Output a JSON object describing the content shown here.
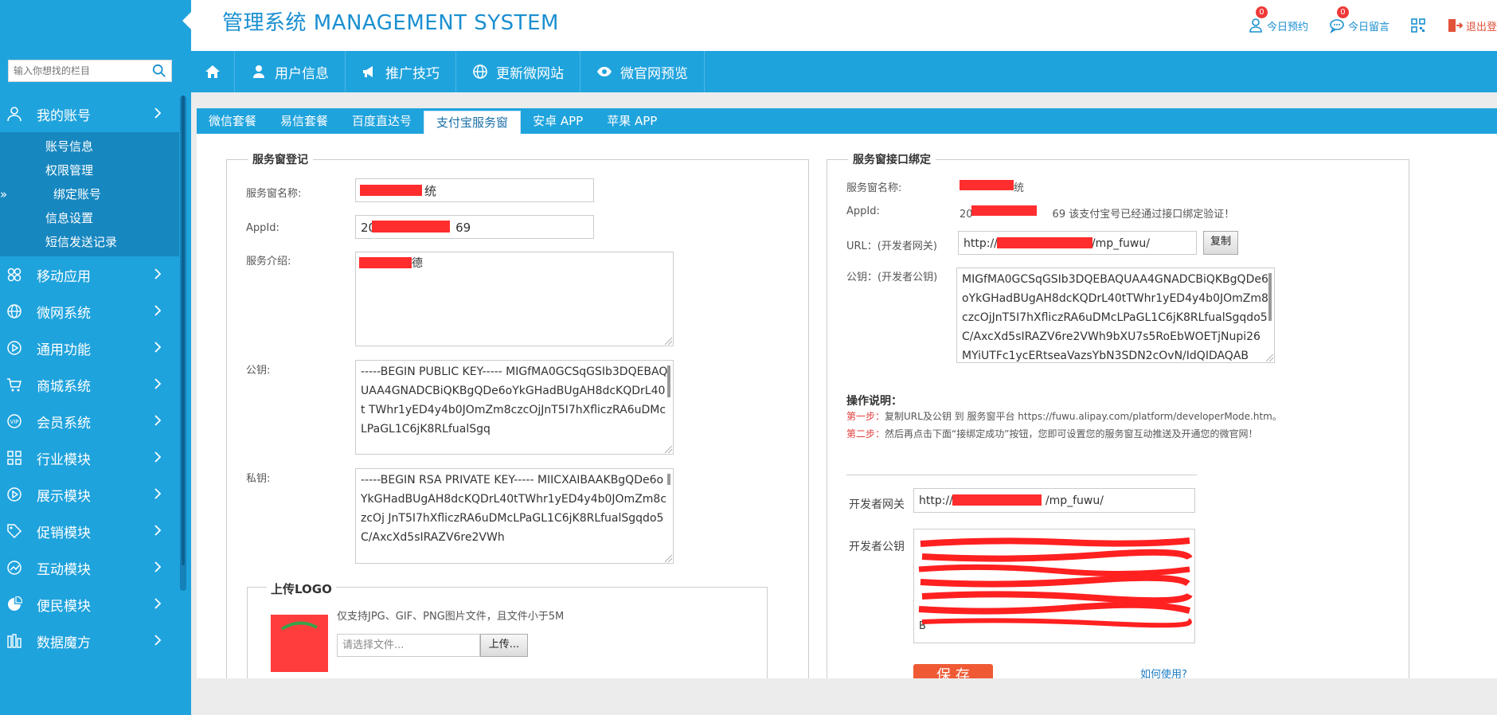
{
  "header": {
    "title": "管理系统 MANAGEMENT SYSTEM",
    "today_booking": "今日预约",
    "today_booking_count": "0",
    "today_message": "今日留言",
    "today_message_count": "0",
    "logout": "退出登"
  },
  "search": {
    "placeholder": "输入你想找的栏目"
  },
  "navbar": {
    "items": [
      {
        "label": "用户信息",
        "icon": "user-icon"
      },
      {
        "label": "推广技巧",
        "icon": "megaphone-icon"
      },
      {
        "label": "更新微网站",
        "icon": "globe-icon"
      },
      {
        "label": "微官网预览",
        "icon": "eye-icon"
      }
    ]
  },
  "sidebar": {
    "account": {
      "label": "我的账号",
      "icon": "user-icon"
    },
    "account_sub": [
      "账号信息",
      "权限管理",
      "绑定账号",
      "信息设置",
      "短信发送记录"
    ],
    "active_sub_arrow": "»",
    "items": [
      {
        "label": "移动应用",
        "icon": "apps-icon"
      },
      {
        "label": "微网系统",
        "icon": "globe-icon"
      },
      {
        "label": "通用功能",
        "icon": "play-circle-icon"
      },
      {
        "label": "商城系统",
        "icon": "cart-icon"
      },
      {
        "label": "会员系统",
        "icon": "vip-icon"
      },
      {
        "label": "行业模块",
        "icon": "grid-icon"
      },
      {
        "label": "展示模块",
        "icon": "play-circle-icon"
      },
      {
        "label": "促销模块",
        "icon": "tag-icon"
      },
      {
        "label": "互动模块",
        "icon": "chart-icon"
      },
      {
        "label": "便民模块",
        "icon": "pie-icon"
      },
      {
        "label": "数据魔方",
        "icon": "cube-icon"
      }
    ]
  },
  "tabs": [
    "微信套餐",
    "易信套餐",
    "百度直达号",
    "支付宝服务窗",
    "安卓 APP",
    "苹果 APP"
  ],
  "register": {
    "legend": "服务窗登记",
    "name_label": "服务窗名称:",
    "name_value_suffix": "统",
    "appid_label": "AppId:",
    "appid_prefix": "20",
    "appid_suffix": "69",
    "intro_label": "服务介绍:",
    "intro_suffix": "德",
    "pubkey_label": "公钥:",
    "pubkey_value": "-----BEGIN PUBLIC KEY----- MIGfMA0GCSqGSIb3DQEBAQUAA4GNADCBiQKBgQDe6oYkGHadBUgAH8dcKQDrL40t TWhr1yED4y4b0JOmZm8czcOjJnT5I7hXfliczRA6uDMcLPaGL1C6jK8RLfualSgq",
    "privkey_label": "私钥:",
    "privkey_value": "-----BEGIN RSA PRIVATE KEY----- MIICXAIBAAKBgQDe6oYkGHadBUgAH8dcKQDrL40tTWhr1yED4y4b0JOmZm8czcOj JnT5I7hXfliczRA6uDMcLPaGL1C6jK8RLfualSgqdo5C/AxcXd5sIRAZV6re2VWh",
    "logo_legend": "上传LOGO",
    "logo_hint": "仅支持JPG、GIF、PNG图片文件，且文件小于5M",
    "file_placeholder": "请选择文件...",
    "upload_label": "上传..."
  },
  "binding": {
    "legend": "服务窗接口绑定",
    "name_label": "服务窗名称:",
    "name_suffix": "统",
    "appid_label": "AppId:",
    "appid_prefix": "20",
    "appid_suffix": "69 该支付宝号已经通过接口绑定验证！",
    "url_label": "URL：(开发者网关)",
    "url_prefix": "http://",
    "url_suffix": "/mp_fuwu/",
    "copy_label": "复制",
    "pubkey_label": "公钥：(开发者公钥)",
    "pubkey_value": "MIGfMA0GCSqGSIb3DQEBAQUAA4GNADCBiQKBgQDe6oYkGHadBUgAH8dcKQDrL40tTWhr1yED4y4b0JOmZm8czcOjJnT5I7hXfliczRA6uDMcLPaGL1C6jK8RLfualSgqdo5C/AxcXd5sIRAZV6re2VWh9bXU7s5RoEbWOETjNupi26MYiUTFc1ycERtseaVazsYbN3SDN2cOvN/IdQIDAQAB",
    "instructions_title": "操作说明：",
    "step1_label": "第一步：",
    "step1_text": "复制URL及公钥 到 服务窗平台 https://fuwu.alipay.com/platform/developerMode.htm。",
    "step2_label": "第二步：",
    "step2_text": "然后再点击下面“接绑定成功”按钮，您即可设置您的服务窗互动推送及开通您的微官网！",
    "gateway_label": "开发者网关",
    "gateway_prefix": "http://",
    "gateway_suffix": "/mp_fuwu/",
    "devkey_label": "开发者公钥",
    "devkey_tail": "B",
    "save_label": "保 存",
    "howto_label": "如何使用?"
  },
  "colors": {
    "primary": "#1fa3dd",
    "submenu": "#1787c0",
    "brand_text": "#1a8fd0",
    "redaction": "#ff2d2d",
    "save_button": "#ef5a35"
  }
}
